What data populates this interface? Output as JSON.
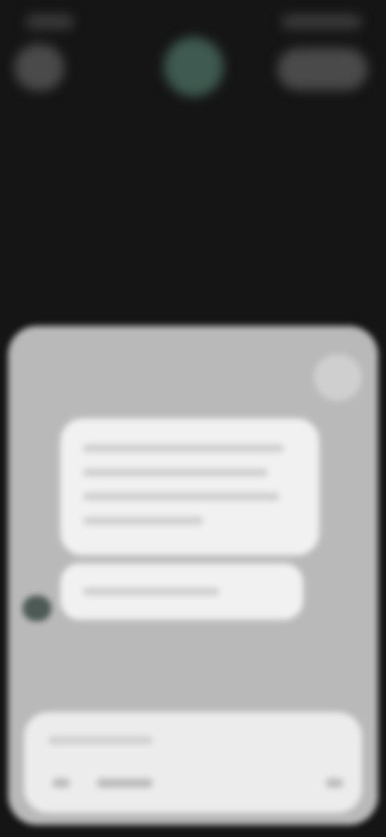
{
  "screen": {
    "state": "blurred overlay with bottom sheet"
  },
  "header": {
    "left_button_icon": "back-icon",
    "center_avatar_icon": "avatar",
    "right_button_icon": "actions-icon"
  },
  "sheet": {
    "close_icon": "close-icon",
    "compose_icons": [
      "attach-icon",
      "mic-icon"
    ]
  },
  "colors": {
    "background": "#151515",
    "sheet": "#b9b9b9",
    "bubble": "#f1f1f1",
    "avatar_accent": "#3f5a50"
  }
}
